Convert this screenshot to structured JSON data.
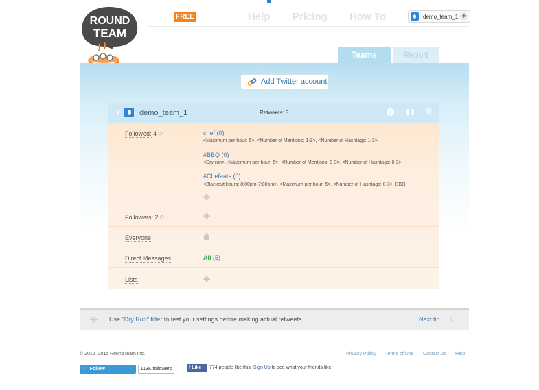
{
  "brand": {
    "logo_top": "ROUND",
    "logo_bottom": "TEAM",
    "free_badge": "FREE"
  },
  "nav": {
    "help": "Help",
    "pricing": "Pricing",
    "how_to": "How To"
  },
  "user": {
    "name": "demo_team_1"
  },
  "tabs": [
    {
      "label": "Teams",
      "active": true
    },
    {
      "label": "Report",
      "active": false
    }
  ],
  "add_account_label": "Add Twitter account",
  "team": {
    "name": "demo_team_1",
    "retweets": "Retweets: 5",
    "followed_label": "Followed:",
    "followed_count": "4",
    "followed": [
      {
        "title": "chef (0)",
        "desc": "<Maximum per hour: 5>, <Number of Mentions: 1-3>, <Number of Hashtags: 1-3>"
      },
      {
        "title": "#BBQ (0)",
        "desc": "<Dry run>, <Maximum per hour: 5>, <Number of Mentions: 0-3>, <Number of Hashtags: 0-3>"
      },
      {
        "title": "#Chefeats (0)",
        "desc": "<Blackout hours: 8:00pm-7:00am>, <Maximum per hour: 5>, <Number of Hashtags: 0-3>, BBQ"
      }
    ],
    "followers_label": "Followers:",
    "followers_count": "2",
    "everyone_label": "Everyone",
    "direct_messages_label": "Direct Messages",
    "direct_messages_all": "All",
    "direct_messages_count": "(5)",
    "lists_label": "Lists"
  },
  "tip": {
    "before": "Use ",
    "highlight": "\"Dry Run\" filter",
    "after": " to test your settings before making actual retweets",
    "next": "Next tip"
  },
  "footer": {
    "copyright": "© 2012–2015 RoundTeam Inc.",
    "links": [
      "Privacy Policy",
      "Terms of Use",
      "Contact us",
      "Help"
    ],
    "twitter_follow": "Follow @RoundTeam",
    "twitter_followers": "113K followers",
    "fb_like": "Like",
    "fb_text_before": "774 people like this. ",
    "fb_signup": "Sign Up",
    "fb_text_after": " to see what your friends like."
  },
  "colors": {
    "accent_orange": "#f6821f",
    "link_blue": "#3b7bb7",
    "team_header": "#cfe8f5",
    "panel_peach": "#fde4ca",
    "dm_green": "#2ba84a"
  }
}
